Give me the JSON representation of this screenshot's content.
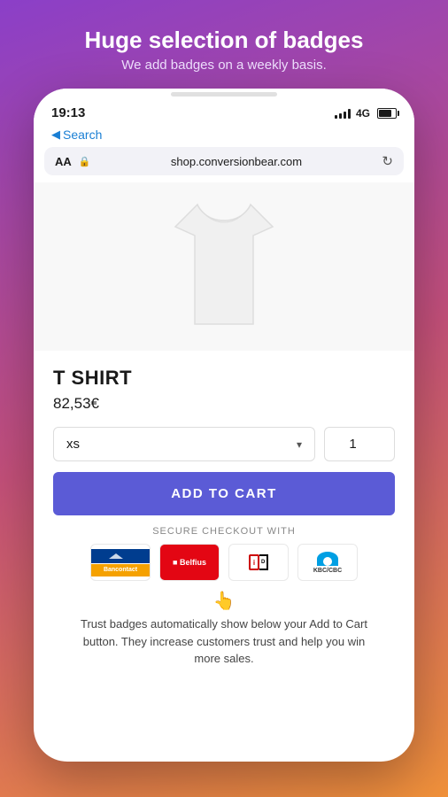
{
  "header": {
    "title": "Huge selection of badges",
    "subtitle": "We add badges on a weekly basis."
  },
  "status_bar": {
    "time": "19:13",
    "signal_label": "4G",
    "back_label": "Search"
  },
  "browser": {
    "aa_label": "AA",
    "url": "shop.conversionbear.com"
  },
  "product": {
    "name": "T SHIRT",
    "price": "82,53€",
    "size_default": "xs",
    "quantity_default": "1"
  },
  "buttons": {
    "add_to_cart": "ADD TO CART"
  },
  "checkout": {
    "secure_label": "SECURE CHECKOUT WITH",
    "payment_methods": [
      {
        "id": "bancontact",
        "label": "Bancontact"
      },
      {
        "id": "belfius",
        "label": "Belfius"
      },
      {
        "id": "ideal",
        "label": "iDEAL"
      },
      {
        "id": "kbc",
        "label": "KBC/CBC"
      }
    ]
  },
  "trust": {
    "emoji": "👆",
    "text": "Trust badges automatically show below your Add to Cart button. They increase customers trust and help you win more sales."
  }
}
